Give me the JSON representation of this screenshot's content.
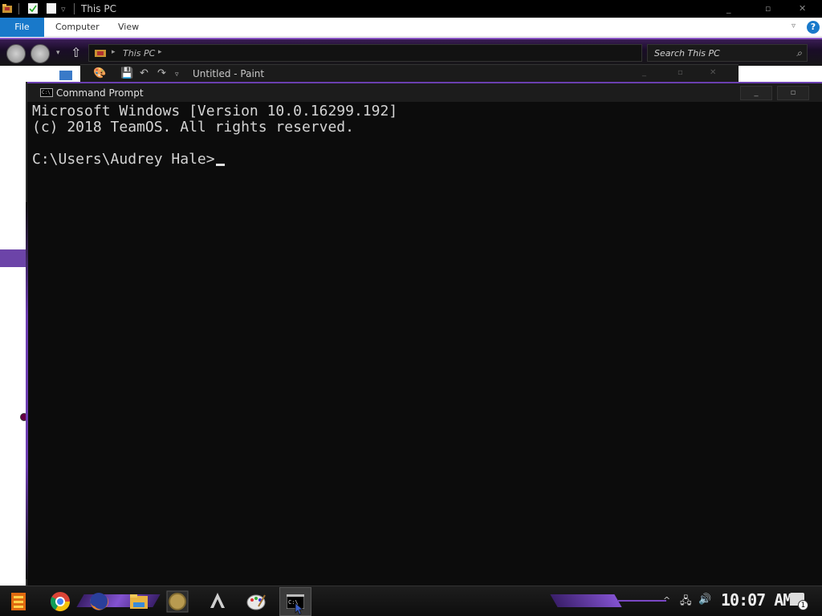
{
  "explorer": {
    "title": "This PC",
    "ribbon_tabs": {
      "file": "File",
      "computer": "Computer",
      "view": "View"
    },
    "address": "This PC",
    "search_placeholder": "Search This PC",
    "help": "?"
  },
  "paint": {
    "title": "Untitled - Paint"
  },
  "cmd": {
    "title": "Command Prompt",
    "lines": [
      "Microsoft Windows [Version 10.0.16299.192]",
      "(c) 2018 TeamOS. All rights reserved.",
      "",
      "C:\\Users\\Audrey Hale>"
    ]
  },
  "taskbar": {
    "apps": [
      "start-icon",
      "chrome-icon",
      "firefox-icon",
      "file-explorer-icon",
      "coin-app-icon",
      "inkscape-icon",
      "paint-icon",
      "command-prompt-icon"
    ],
    "clock": "10:07 AM",
    "notification_count": "1"
  },
  "colors": {
    "accent_purple": "#7c4dc4",
    "file_tab_blue": "#1979ca",
    "console_bg": "#0c0c0c"
  }
}
